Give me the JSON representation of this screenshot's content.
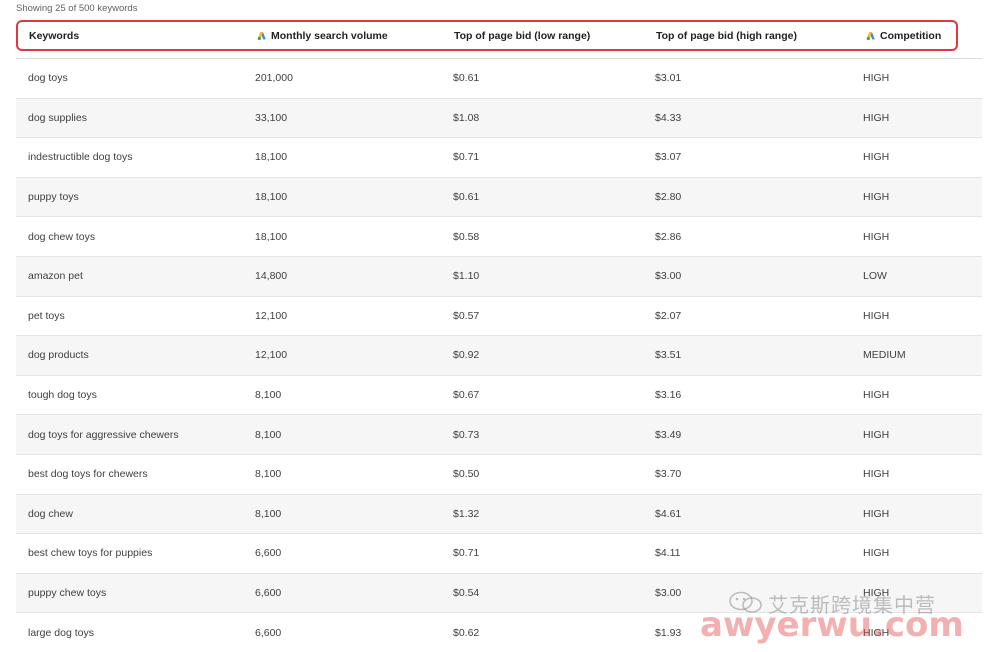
{
  "caption": "Showing 25 of 500 keywords",
  "columns": [
    {
      "label": "Keywords",
      "icon": null
    },
    {
      "label": "Monthly search volume",
      "icon": "google-ads-icon"
    },
    {
      "label": "Top of page bid (low range)",
      "icon": null
    },
    {
      "label": "Top of page bid (high range)",
      "icon": null
    },
    {
      "label": "Competition",
      "icon": "google-ads-icon"
    }
  ],
  "rows": [
    [
      "dog toys",
      "201,000",
      "$0.61",
      "$3.01",
      "HIGH"
    ],
    [
      "dog supplies",
      "33,100",
      "$1.08",
      "$4.33",
      "HIGH"
    ],
    [
      "indestructible dog toys",
      "18,100",
      "$0.71",
      "$3.07",
      "HIGH"
    ],
    [
      "puppy toys",
      "18,100",
      "$0.61",
      "$2.80",
      "HIGH"
    ],
    [
      "dog chew toys",
      "18,100",
      "$0.58",
      "$2.86",
      "HIGH"
    ],
    [
      "amazon pet",
      "14,800",
      "$1.10",
      "$3.00",
      "LOW"
    ],
    [
      "pet toys",
      "12,100",
      "$0.57",
      "$2.07",
      "HIGH"
    ],
    [
      "dog products",
      "12,100",
      "$0.92",
      "$3.51",
      "MEDIUM"
    ],
    [
      "tough dog toys",
      "8,100",
      "$0.67",
      "$3.16",
      "HIGH"
    ],
    [
      "dog toys for aggressive chewers",
      "8,100",
      "$0.73",
      "$3.49",
      "HIGH"
    ],
    [
      "best dog toys for chewers",
      "8,100",
      "$0.50",
      "$3.70",
      "HIGH"
    ],
    [
      "dog chew",
      "8,100",
      "$1.32",
      "$4.61",
      "HIGH"
    ],
    [
      "best chew toys for puppies",
      "6,600",
      "$0.71",
      "$4.11",
      "HIGH"
    ],
    [
      "puppy chew toys",
      "6,600",
      "$0.54",
      "$3.00",
      "HIGH"
    ],
    [
      "large dog toys",
      "6,600",
      "$0.62",
      "$1.93",
      "HIGH"
    ]
  ],
  "watermark": {
    "top_text": "艾克斯跨境集中营",
    "bottom_text": "awyerwu.com"
  },
  "colors": {
    "highlight_border": "#e0393e",
    "ads_blue": "#4285f4",
    "ads_yellow": "#fbbc04",
    "ads_green": "#34a853"
  }
}
